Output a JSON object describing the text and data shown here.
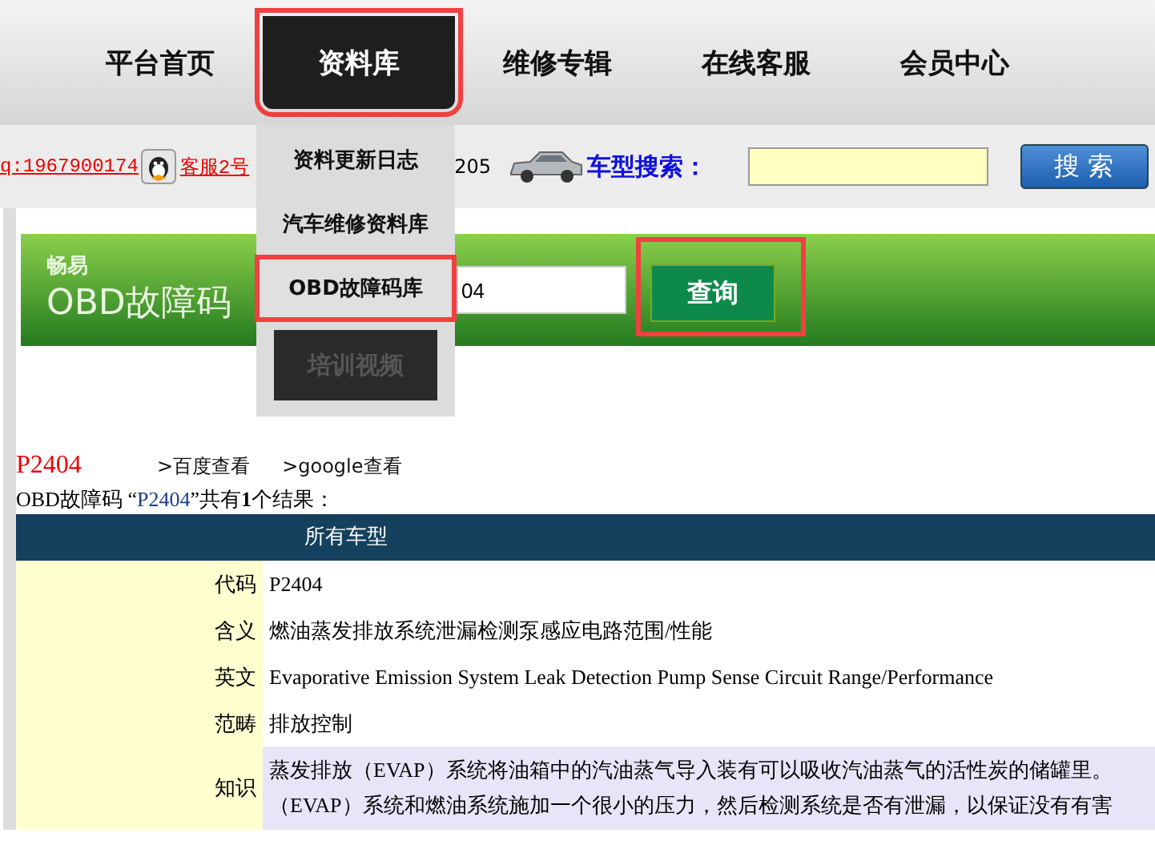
{
  "nav": {
    "tabs": [
      {
        "label": "平台首页",
        "selected": false
      },
      {
        "label": "资料库",
        "selected": true
      },
      {
        "label": "维修专辑",
        "selected": false
      },
      {
        "label": "在线客服",
        "selected": false
      },
      {
        "label": "会员中心",
        "selected": false
      }
    ]
  },
  "contact": {
    "qq": "q:1967900174",
    "service": "客服2号",
    "phone_tail": "205"
  },
  "car_search": {
    "label": "车型搜索：",
    "button": "搜 索"
  },
  "dropdown": {
    "items": [
      {
        "label": "资料更新日志",
        "selected": false
      },
      {
        "label": "汽车维修资料库",
        "selected": false
      },
      {
        "label": "OBD故障码库",
        "selected": true
      }
    ],
    "next_tab": "培训视频"
  },
  "banner": {
    "brand": "畅易",
    "title": "OBD故障码",
    "value": "04",
    "button": "查询"
  },
  "result": {
    "code": "P2404",
    "links": [
      ">百度查看",
      ">google查看"
    ],
    "summary": [
      {
        "kind": "plain",
        "text": "OBD故障码 “"
      },
      {
        "kind": "code",
        "text": "P2404"
      },
      {
        "kind": "plain",
        "text": "”共有**1**个结果："
      }
    ],
    "table_header": "所有车型",
    "rows": [
      {
        "label": "代码",
        "lines": [
          "P2404"
        ]
      },
      {
        "label": "含义",
        "lines": [
          "燃油蒸发排放系统泄漏检测泵感应电路范围/性能"
        ]
      },
      {
        "label": "英文",
        "lines": [
          "Evaporative Emission System Leak Detection Pump Sense Circuit Range/Performance"
        ]
      },
      {
        "label": "范畴",
        "lines": [
          "排放控制"
        ]
      },
      {
        "label": "知识",
        "lines": [
          "蒸发排放（EVAP）系统将油箱中的汽油蒸气导入装有可以吸收汽油蒸气的活性炭的储罐里。",
          "（EVAP）系统和燃油系统施加一个很小的压力，然后检测系统是否有泄漏，以保证没有有害"
        ]
      }
    ]
  }
}
